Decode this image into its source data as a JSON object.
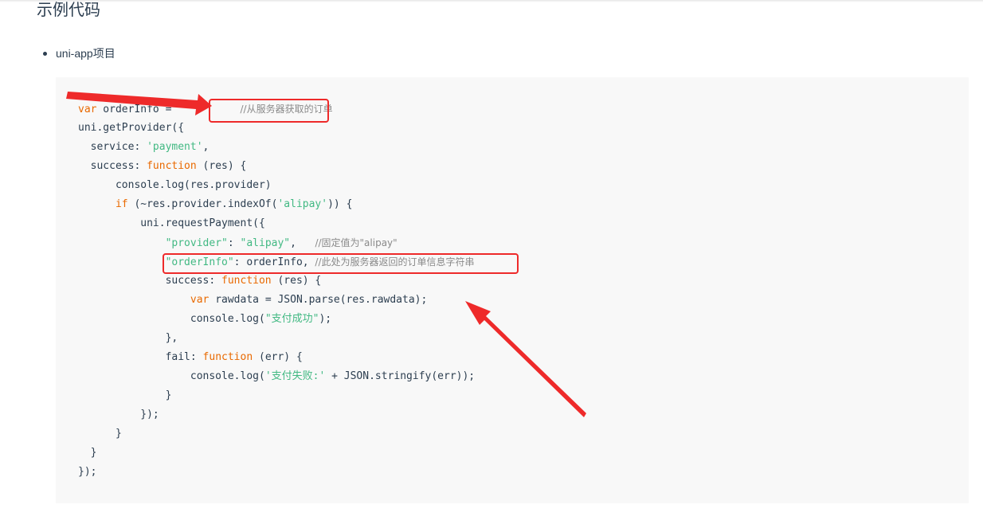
{
  "page": {
    "title": "示例代码",
    "bullet": "uni-app项目"
  },
  "code": {
    "lines": [
      [
        {
          "t": "var",
          "c": "kw"
        },
        {
          "t": " orderInfo = ",
          "c": ""
        },
        {
          "t": "          ",
          "c": ""
        },
        {
          "t": "//从服务器获取的订单",
          "c": "cmt"
        }
      ],
      [
        {
          "t": "uni.getProvider({",
          "c": ""
        }
      ],
      [
        {
          "t": "  service: ",
          "c": ""
        },
        {
          "t": "'payment'",
          "c": "str"
        },
        {
          "t": ",",
          "c": ""
        }
      ],
      [
        {
          "t": "  success: ",
          "c": ""
        },
        {
          "t": "function",
          "c": "kw"
        },
        {
          "t": " (res) {",
          "c": ""
        }
      ],
      [
        {
          "t": "      console.log(res.provider)",
          "c": ""
        }
      ],
      [
        {
          "t": "      ",
          "c": ""
        },
        {
          "t": "if",
          "c": "kw"
        },
        {
          "t": " (~res.provider.indexOf(",
          "c": ""
        },
        {
          "t": "'alipay'",
          "c": "str"
        },
        {
          "t": ")) {",
          "c": ""
        }
      ],
      [
        {
          "t": "          uni.requestPayment({",
          "c": ""
        }
      ],
      [
        {
          "t": "              ",
          "c": ""
        },
        {
          "t": "\"provider\"",
          "c": "str"
        },
        {
          "t": ": ",
          "c": ""
        },
        {
          "t": "\"alipay\"",
          "c": "str"
        },
        {
          "t": ",   ",
          "c": ""
        },
        {
          "t": "//固定值为\"alipay\"",
          "c": "cmt"
        }
      ],
      [
        {
          "t": "              ",
          "c": ""
        },
        {
          "t": "\"orderInfo\"",
          "c": "str"
        },
        {
          "t": ": orderInfo, ",
          "c": ""
        },
        {
          "t": "//此处为服务器返回的订单信息字符串",
          "c": "cmt"
        }
      ],
      [
        {
          "t": "              success: ",
          "c": ""
        },
        {
          "t": "function",
          "c": "kw"
        },
        {
          "t": " (res) {",
          "c": ""
        }
      ],
      [
        {
          "t": "                  ",
          "c": ""
        },
        {
          "t": "var",
          "c": "kw"
        },
        {
          "t": " rawdata = JSON.parse(res.rawdata);",
          "c": ""
        }
      ],
      [
        {
          "t": "                  console.log(",
          "c": ""
        },
        {
          "t": "\"支付成功\"",
          "c": "str"
        },
        {
          "t": ");",
          "c": ""
        }
      ],
      [
        {
          "t": "              },",
          "c": ""
        }
      ],
      [
        {
          "t": "              fail: ",
          "c": ""
        },
        {
          "t": "function",
          "c": "kw"
        },
        {
          "t": " (err) {",
          "c": ""
        }
      ],
      [
        {
          "t": "                  console.log(",
          "c": ""
        },
        {
          "t": "'支付失败:'",
          "c": "str"
        },
        {
          "t": " + JSON.stringify(err));",
          "c": ""
        }
      ],
      [
        {
          "t": "              }",
          "c": ""
        }
      ],
      [
        {
          "t": "          });",
          "c": ""
        }
      ],
      [
        {
          "t": "      }",
          "c": ""
        }
      ],
      [
        {
          "t": "  }",
          "c": ""
        }
      ],
      [
        {
          "t": "});",
          "c": ""
        }
      ]
    ]
  },
  "colors": {
    "annotation_red": "#ee2a2a",
    "keyword": "#e96900",
    "string": "#42b983",
    "comment": "#8a8a8a"
  }
}
